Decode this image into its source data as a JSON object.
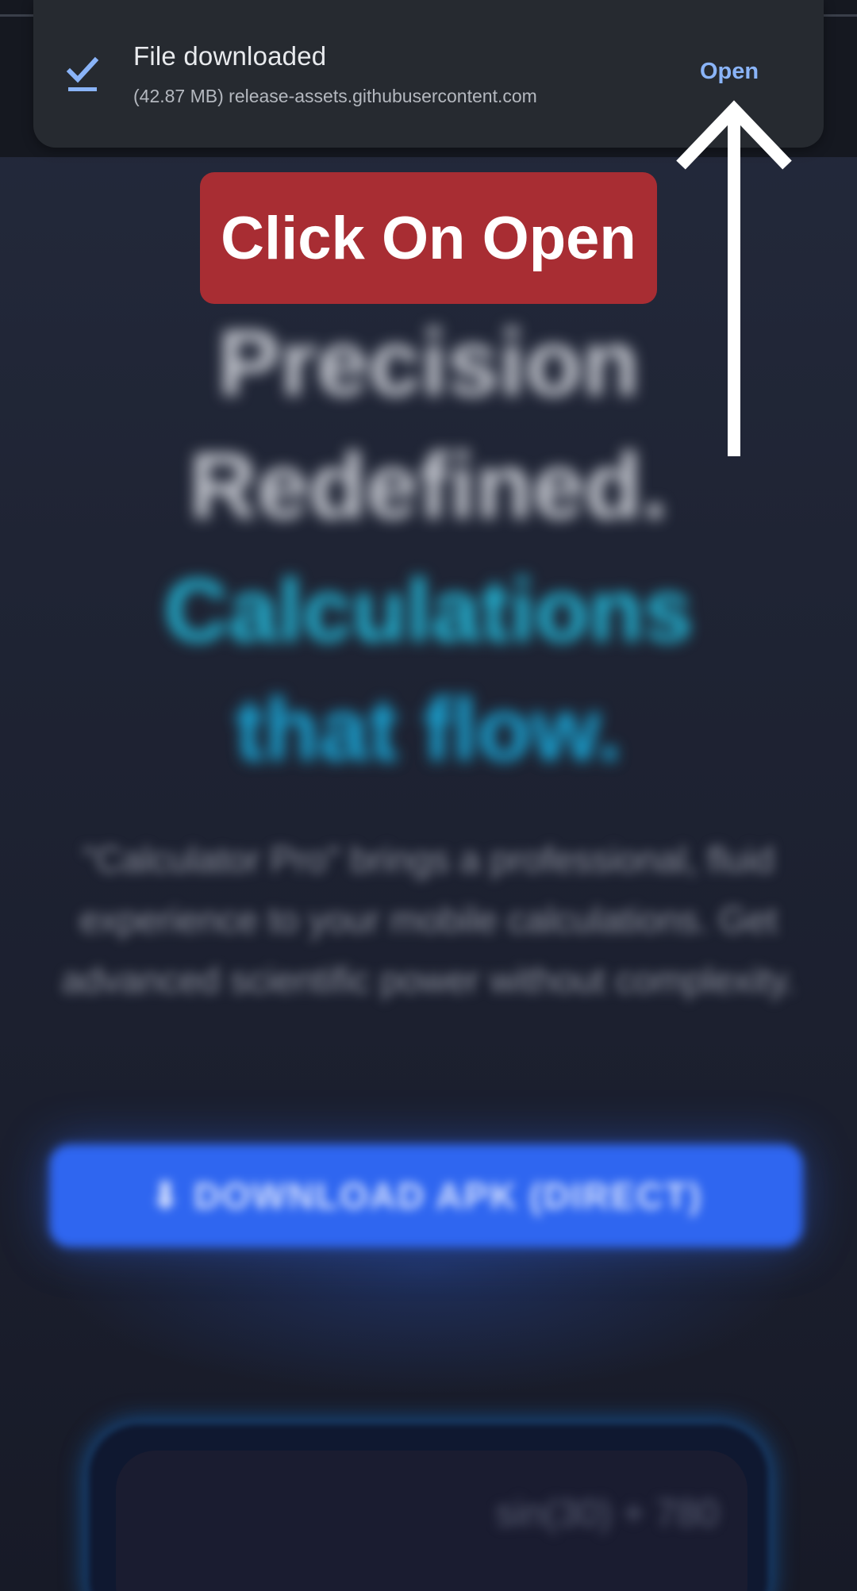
{
  "notification": {
    "title": "File downloaded",
    "subtitle": "(42.87 MB) release-assets.githubusercontent.com",
    "action_label": "Open",
    "icon": "download-done-icon",
    "accent_color": "#8ab4f8"
  },
  "overlay": {
    "callout_text": "Click On Open",
    "callout_color": "#a82d33",
    "arrow_icon": "up-arrow-icon"
  },
  "page": {
    "hero_line_1": "Precision",
    "hero_line_2": "Redefined.",
    "hero_line_3": "Calculations",
    "hero_line_4": "that flow.",
    "description": "\"Calculator Pro\" brings a professional, fluid experience to your mobile calculations. Get advanced scientific power without complexity.",
    "cta_label": "⬇ DOWNLOAD APK (DIRECT)",
    "calc_display": "sin(30) + 780",
    "accent_cyan": "#23b6d6",
    "cta_color": "#2f66f0"
  }
}
